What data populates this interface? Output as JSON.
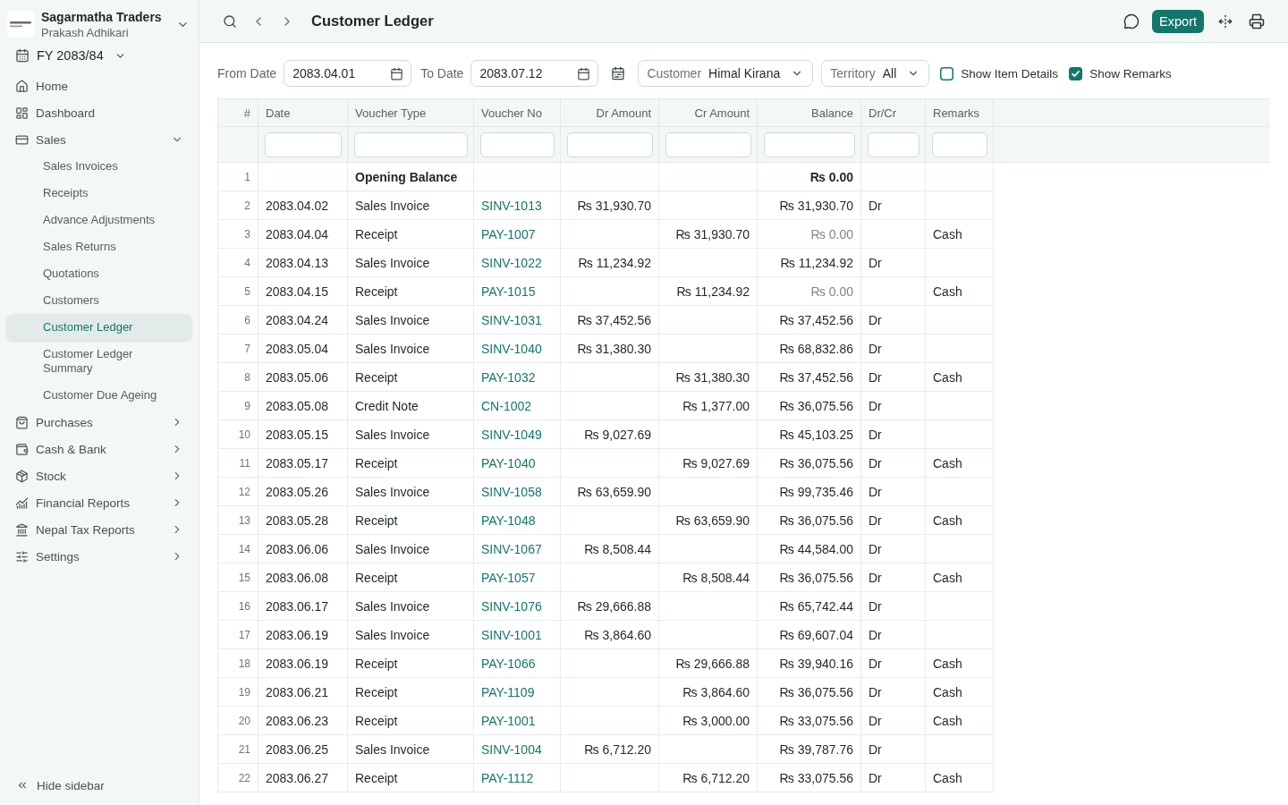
{
  "sidebar": {
    "company": "Sagarmatha Traders",
    "user": "Prakash Adhikari",
    "fiscal_year": "FY 2083/84",
    "items": [
      {
        "label": "Home",
        "kind": "link"
      },
      {
        "label": "Dashboard",
        "kind": "link"
      },
      {
        "label": "Sales",
        "kind": "group",
        "expanded": true,
        "children": [
          {
            "label": "Sales Invoices",
            "selected": false
          },
          {
            "label": "Receipts",
            "selected": false
          },
          {
            "label": "Advance Adjustments",
            "selected": false
          },
          {
            "label": "Sales Returns",
            "selected": false
          },
          {
            "label": "Quotations",
            "selected": false
          },
          {
            "label": "Customers",
            "selected": false
          },
          {
            "label": "Customer Ledger",
            "selected": true
          },
          {
            "label": "Customer Ledger Summary",
            "selected": false
          },
          {
            "label": "Customer Due Ageing",
            "selected": false
          }
        ]
      },
      {
        "label": "Purchases",
        "kind": "group",
        "expanded": false
      },
      {
        "label": "Cash & Bank",
        "kind": "group",
        "expanded": false
      },
      {
        "label": "Stock",
        "kind": "group",
        "expanded": false
      },
      {
        "label": "Financial Reports",
        "kind": "group",
        "expanded": false
      },
      {
        "label": "Nepal Tax Reports",
        "kind": "group",
        "expanded": false
      },
      {
        "label": "Settings",
        "kind": "group",
        "expanded": false
      }
    ],
    "hide_sidebar": "Hide sidebar"
  },
  "toolbar": {
    "title": "Customer Ledger",
    "export": "Export"
  },
  "filters": {
    "from_date": {
      "label": "From Date",
      "value": "2083.04.01"
    },
    "to_date": {
      "label": "To Date",
      "value": "2083.07.12"
    },
    "customer": {
      "label": "Customer",
      "value": "Himal Kirana"
    },
    "territory": {
      "label": "Territory",
      "value": "All"
    },
    "checkboxes": [
      {
        "label": "Show Item Details",
        "checked": false
      },
      {
        "label": "Show Remarks",
        "checked": true
      }
    ]
  },
  "table": {
    "columns": [
      {
        "label": "#",
        "filter": false
      },
      {
        "label": "Date",
        "filter": true
      },
      {
        "label": "Voucher Type",
        "filter": true
      },
      {
        "label": "Voucher No",
        "filter": true
      },
      {
        "label": "Dr Amount",
        "filter": true
      },
      {
        "label": "Cr Amount",
        "filter": true
      },
      {
        "label": "Balance",
        "filter": true
      },
      {
        "label": "Dr/Cr",
        "filter": true
      },
      {
        "label": "Remarks",
        "filter": true
      }
    ],
    "rows": [
      {
        "no": "1",
        "kind": "opening",
        "voucher_type": "Opening Balance",
        "balance": "₨ 0.00",
        "settled": false
      },
      {
        "no": "2",
        "kind": "entry",
        "date": "2083.04.02",
        "voucher_type": "Sales Invoice",
        "voucher_no": "SINV-1013",
        "dr_amount": "₨ 31,930.70",
        "balance": "₨ 31,930.70",
        "dr_cr": "Dr",
        "settled": false
      },
      {
        "no": "3",
        "kind": "entry",
        "date": "2083.04.04",
        "voucher_type": "Receipt",
        "voucher_no": "PAY-1007",
        "cr_amount": "₨ 31,930.70",
        "balance": "₨ 0.00",
        "remarks": "Cash",
        "settled": true
      },
      {
        "no": "4",
        "kind": "entry",
        "date": "2083.04.13",
        "voucher_type": "Sales Invoice",
        "voucher_no": "SINV-1022",
        "dr_amount": "₨ 11,234.92",
        "balance": "₨ 11,234.92",
        "dr_cr": "Dr",
        "settled": false
      },
      {
        "no": "5",
        "kind": "entry",
        "date": "2083.04.15",
        "voucher_type": "Receipt",
        "voucher_no": "PAY-1015",
        "cr_amount": "₨ 11,234.92",
        "balance": "₨ 0.00",
        "remarks": "Cash",
        "settled": true
      },
      {
        "no": "6",
        "kind": "entry",
        "date": "2083.04.24",
        "voucher_type": "Sales Invoice",
        "voucher_no": "SINV-1031",
        "dr_amount": "₨ 37,452.56",
        "balance": "₨ 37,452.56",
        "dr_cr": "Dr",
        "settled": false
      },
      {
        "no": "7",
        "kind": "entry",
        "date": "2083.05.04",
        "voucher_type": "Sales Invoice",
        "voucher_no": "SINV-1040",
        "dr_amount": "₨ 31,380.30",
        "balance": "₨ 68,832.86",
        "dr_cr": "Dr",
        "settled": false
      },
      {
        "no": "8",
        "kind": "entry",
        "date": "2083.05.06",
        "voucher_type": "Receipt",
        "voucher_no": "PAY-1032",
        "cr_amount": "₨ 31,380.30",
        "balance": "₨ 37,452.56",
        "dr_cr": "Dr",
        "remarks": "Cash",
        "settled": false
      },
      {
        "no": "9",
        "kind": "entry",
        "date": "2083.05.08",
        "voucher_type": "Credit Note",
        "voucher_no": "CN-1002",
        "cr_amount": "₨ 1,377.00",
        "balance": "₨ 36,075.56",
        "dr_cr": "Dr",
        "settled": false
      },
      {
        "no": "10",
        "kind": "entry",
        "date": "2083.05.15",
        "voucher_type": "Sales Invoice",
        "voucher_no": "SINV-1049",
        "dr_amount": "₨ 9,027.69",
        "balance": "₨ 45,103.25",
        "dr_cr": "Dr",
        "settled": false
      },
      {
        "no": "11",
        "kind": "entry",
        "date": "2083.05.17",
        "voucher_type": "Receipt",
        "voucher_no": "PAY-1040",
        "cr_amount": "₨ 9,027.69",
        "balance": "₨ 36,075.56",
        "dr_cr": "Dr",
        "remarks": "Cash",
        "settled": false
      },
      {
        "no": "12",
        "kind": "entry",
        "date": "2083.05.26",
        "voucher_type": "Sales Invoice",
        "voucher_no": "SINV-1058",
        "dr_amount": "₨ 63,659.90",
        "balance": "₨ 99,735.46",
        "dr_cr": "Dr",
        "settled": false
      },
      {
        "no": "13",
        "kind": "entry",
        "date": "2083.05.28",
        "voucher_type": "Receipt",
        "voucher_no": "PAY-1048",
        "cr_amount": "₨ 63,659.90",
        "balance": "₨ 36,075.56",
        "dr_cr": "Dr",
        "remarks": "Cash",
        "settled": false
      },
      {
        "no": "14",
        "kind": "entry",
        "date": "2083.06.06",
        "voucher_type": "Sales Invoice",
        "voucher_no": "SINV-1067",
        "dr_amount": "₨ 8,508.44",
        "balance": "₨ 44,584.00",
        "dr_cr": "Dr",
        "settled": false
      },
      {
        "no": "15",
        "kind": "entry",
        "date": "2083.06.08",
        "voucher_type": "Receipt",
        "voucher_no": "PAY-1057",
        "cr_amount": "₨ 8,508.44",
        "balance": "₨ 36,075.56",
        "dr_cr": "Dr",
        "remarks": "Cash",
        "settled": false
      },
      {
        "no": "16",
        "kind": "entry",
        "date": "2083.06.17",
        "voucher_type": "Sales Invoice",
        "voucher_no": "SINV-1076",
        "dr_amount": "₨ 29,666.88",
        "balance": "₨ 65,742.44",
        "dr_cr": "Dr",
        "settled": false
      },
      {
        "no": "17",
        "kind": "entry",
        "date": "2083.06.19",
        "voucher_type": "Sales Invoice",
        "voucher_no": "SINV-1001",
        "dr_amount": "₨ 3,864.60",
        "balance": "₨ 69,607.04",
        "dr_cr": "Dr",
        "settled": false
      },
      {
        "no": "18",
        "kind": "entry",
        "date": "2083.06.19",
        "voucher_type": "Receipt",
        "voucher_no": "PAY-1066",
        "cr_amount": "₨ 29,666.88",
        "balance": "₨ 39,940.16",
        "dr_cr": "Dr",
        "remarks": "Cash",
        "settled": false
      },
      {
        "no": "19",
        "kind": "entry",
        "date": "2083.06.21",
        "voucher_type": "Receipt",
        "voucher_no": "PAY-1109",
        "cr_amount": "₨ 3,864.60",
        "balance": "₨ 36,075.56",
        "dr_cr": "Dr",
        "remarks": "Cash",
        "settled": false
      },
      {
        "no": "20",
        "kind": "entry",
        "date": "2083.06.23",
        "voucher_type": "Receipt",
        "voucher_no": "PAY-1001",
        "cr_amount": "₨ 3,000.00",
        "balance": "₨ 33,075.56",
        "dr_cr": "Dr",
        "remarks": "Cash",
        "settled": false
      },
      {
        "no": "21",
        "kind": "entry",
        "date": "2083.06.25",
        "voucher_type": "Sales Invoice",
        "voucher_no": "SINV-1004",
        "dr_amount": "₨ 6,712.20",
        "balance": "₨ 39,787.76",
        "dr_cr": "Dr",
        "settled": false
      },
      {
        "no": "22",
        "kind": "entry",
        "date": "2083.06.27",
        "voucher_type": "Receipt",
        "voucher_no": "PAY-1112",
        "cr_amount": "₨ 6,712.20",
        "balance": "₨ 33,075.56",
        "dr_cr": "Dr",
        "remarks": "Cash",
        "settled": false
      }
    ]
  }
}
